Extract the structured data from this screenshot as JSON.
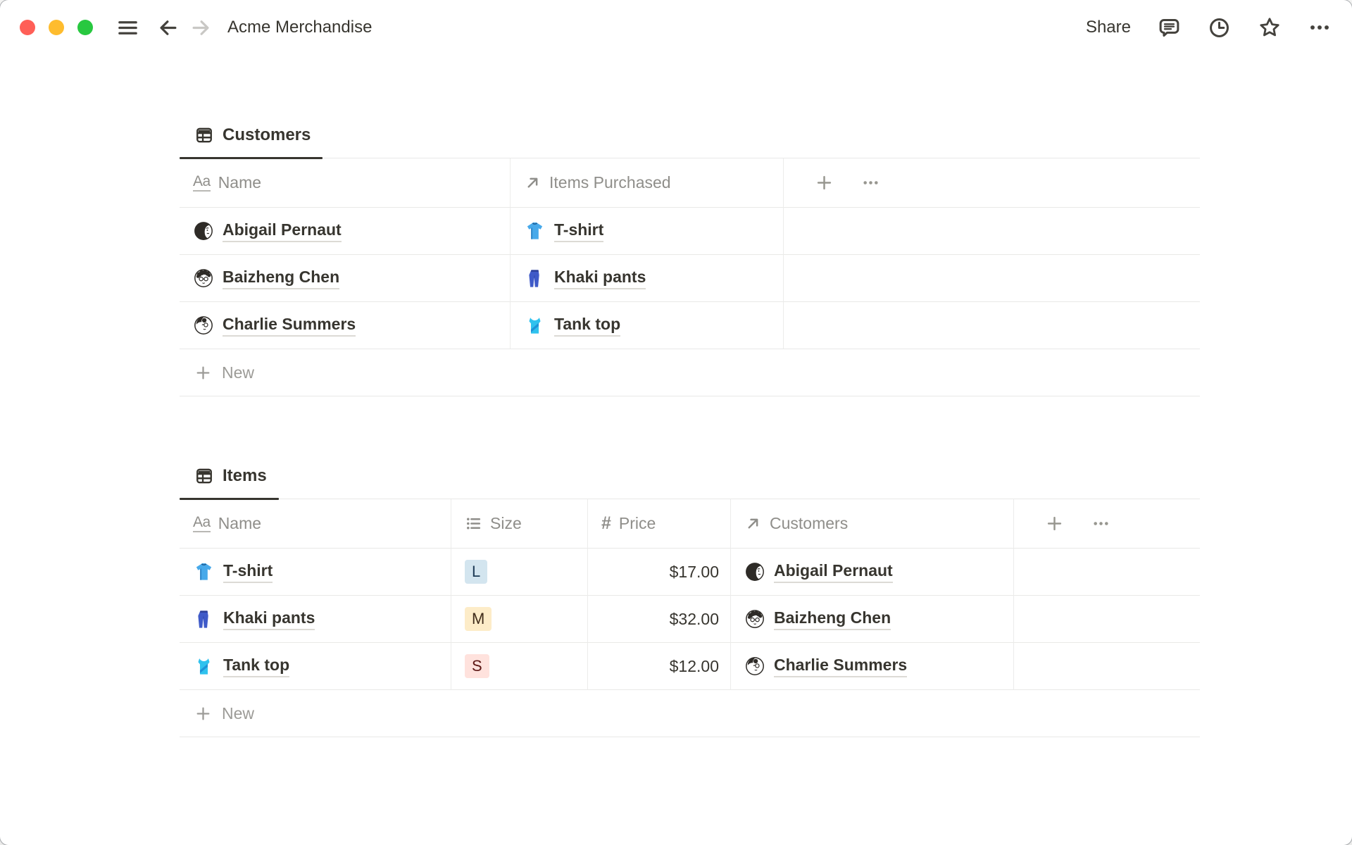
{
  "titlebar": {
    "title": "Acme Merchandise",
    "share_label": "Share",
    "icons": [
      "hamburger-menu",
      "back-arrow",
      "forward-arrow",
      "comments",
      "updates-clock",
      "favorite-star",
      "more-ellipsis"
    ]
  },
  "traffic_lights": {
    "close": "#ff5f57",
    "minimize": "#febc2e",
    "zoom": "#28c840"
  },
  "property_glyphs": {
    "text_glyph": "Aa",
    "number_glyph": "#"
  },
  "customers_table": {
    "tab_label": "Customers",
    "tab_icon": "table-view",
    "columns": [
      {
        "icon": "text-property",
        "label": "Name"
      },
      {
        "icon": "relation-property",
        "label": "Items Purchased"
      }
    ],
    "rows": [
      {
        "avatar": "abigail",
        "name": "Abigail Pernaut",
        "item_icon": "tshirt",
        "item": "T-shirt"
      },
      {
        "avatar": "baizheng",
        "name": "Baizheng Chen",
        "item_icon": "khaki-pants",
        "item": "Khaki pants"
      },
      {
        "avatar": "charlie",
        "name": "Charlie Summers",
        "item_icon": "tank-top",
        "item": "Tank top"
      }
    ],
    "new_label": "New"
  },
  "items_table": {
    "tab_label": "Items",
    "tab_icon": "table-view",
    "columns": [
      {
        "icon": "text-property",
        "label": "Name"
      },
      {
        "icon": "select-property",
        "label": "Size"
      },
      {
        "icon": "number-property",
        "label": "Price"
      },
      {
        "icon": "relation-property",
        "label": "Customers"
      }
    ],
    "rows": [
      {
        "item_icon": "tshirt",
        "name": "T-shirt",
        "size": "L",
        "size_color": "blue",
        "price": "$17.00",
        "avatar": "abigail",
        "customer": "Abigail Pernaut"
      },
      {
        "item_icon": "khaki-pants",
        "name": "Khaki pants",
        "size": "M",
        "size_color": "yellow",
        "price": "$32.00",
        "avatar": "baizheng",
        "customer": "Baizheng Chen"
      },
      {
        "item_icon": "tank-top",
        "name": "Tank top",
        "size": "S",
        "size_color": "red",
        "price": "$12.00",
        "avatar": "charlie",
        "customer": "Charlie Summers"
      }
    ],
    "new_label": "New"
  },
  "colors": {
    "ink": "#37352f",
    "muted_text": "#8f8e8a",
    "divider": "#e9e9e7",
    "tab_underline": "#37352f",
    "badge_blue_bg": "#d3e5ef",
    "badge_yellow_bg": "#fdecc8",
    "badge_red_bg": "#ffe2dd"
  }
}
